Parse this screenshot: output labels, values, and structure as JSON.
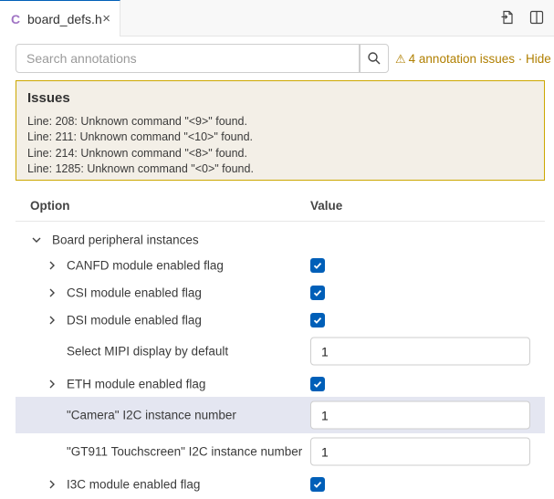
{
  "tab": {
    "language_icon": "C",
    "filename": "board_defs.h",
    "close": "×",
    "actions": [
      "open-file-icon",
      "split-editor-icon"
    ]
  },
  "search": {
    "placeholder": "Search annotations",
    "value": ""
  },
  "issues_link": {
    "text": "4 annotation issues · Hide"
  },
  "issues": {
    "title": "Issues",
    "lines": [
      "Line: 208: Unknown command \"<9>\" found.",
      "Line: 211: Unknown command \"<10>\" found.",
      "Line: 214: Unknown command \"<8>\" found.",
      "Line: 1285: Unknown command \"<0>\" found."
    ]
  },
  "table": {
    "col_option": "Option",
    "col_value": "Value",
    "group_label": "Board peripheral instances",
    "rows": [
      {
        "label": "CANFD module enabled flag",
        "type": "checkbox",
        "checked": true
      },
      {
        "label": "CSI module enabled flag",
        "type": "checkbox",
        "checked": true
      },
      {
        "label": "DSI module enabled flag",
        "type": "checkbox",
        "checked": true
      },
      {
        "label": "Select MIPI display by default",
        "type": "number",
        "value": "1"
      },
      {
        "label": "ETH module enabled flag",
        "type": "checkbox",
        "checked": true
      },
      {
        "label": "\"Camera\" I2C instance number",
        "type": "number",
        "value": "1"
      },
      {
        "label": "\"GT911 Touchscreen\" I2C instance number",
        "type": "number",
        "value": "1"
      },
      {
        "label": "I3C module enabled flag",
        "type": "checkbox",
        "checked": true
      }
    ]
  },
  "colors": {
    "accent": "#005fb8",
    "warning": "#b07f00",
    "issues_border": "#cca700",
    "selected_row": "#e4e6f1"
  }
}
